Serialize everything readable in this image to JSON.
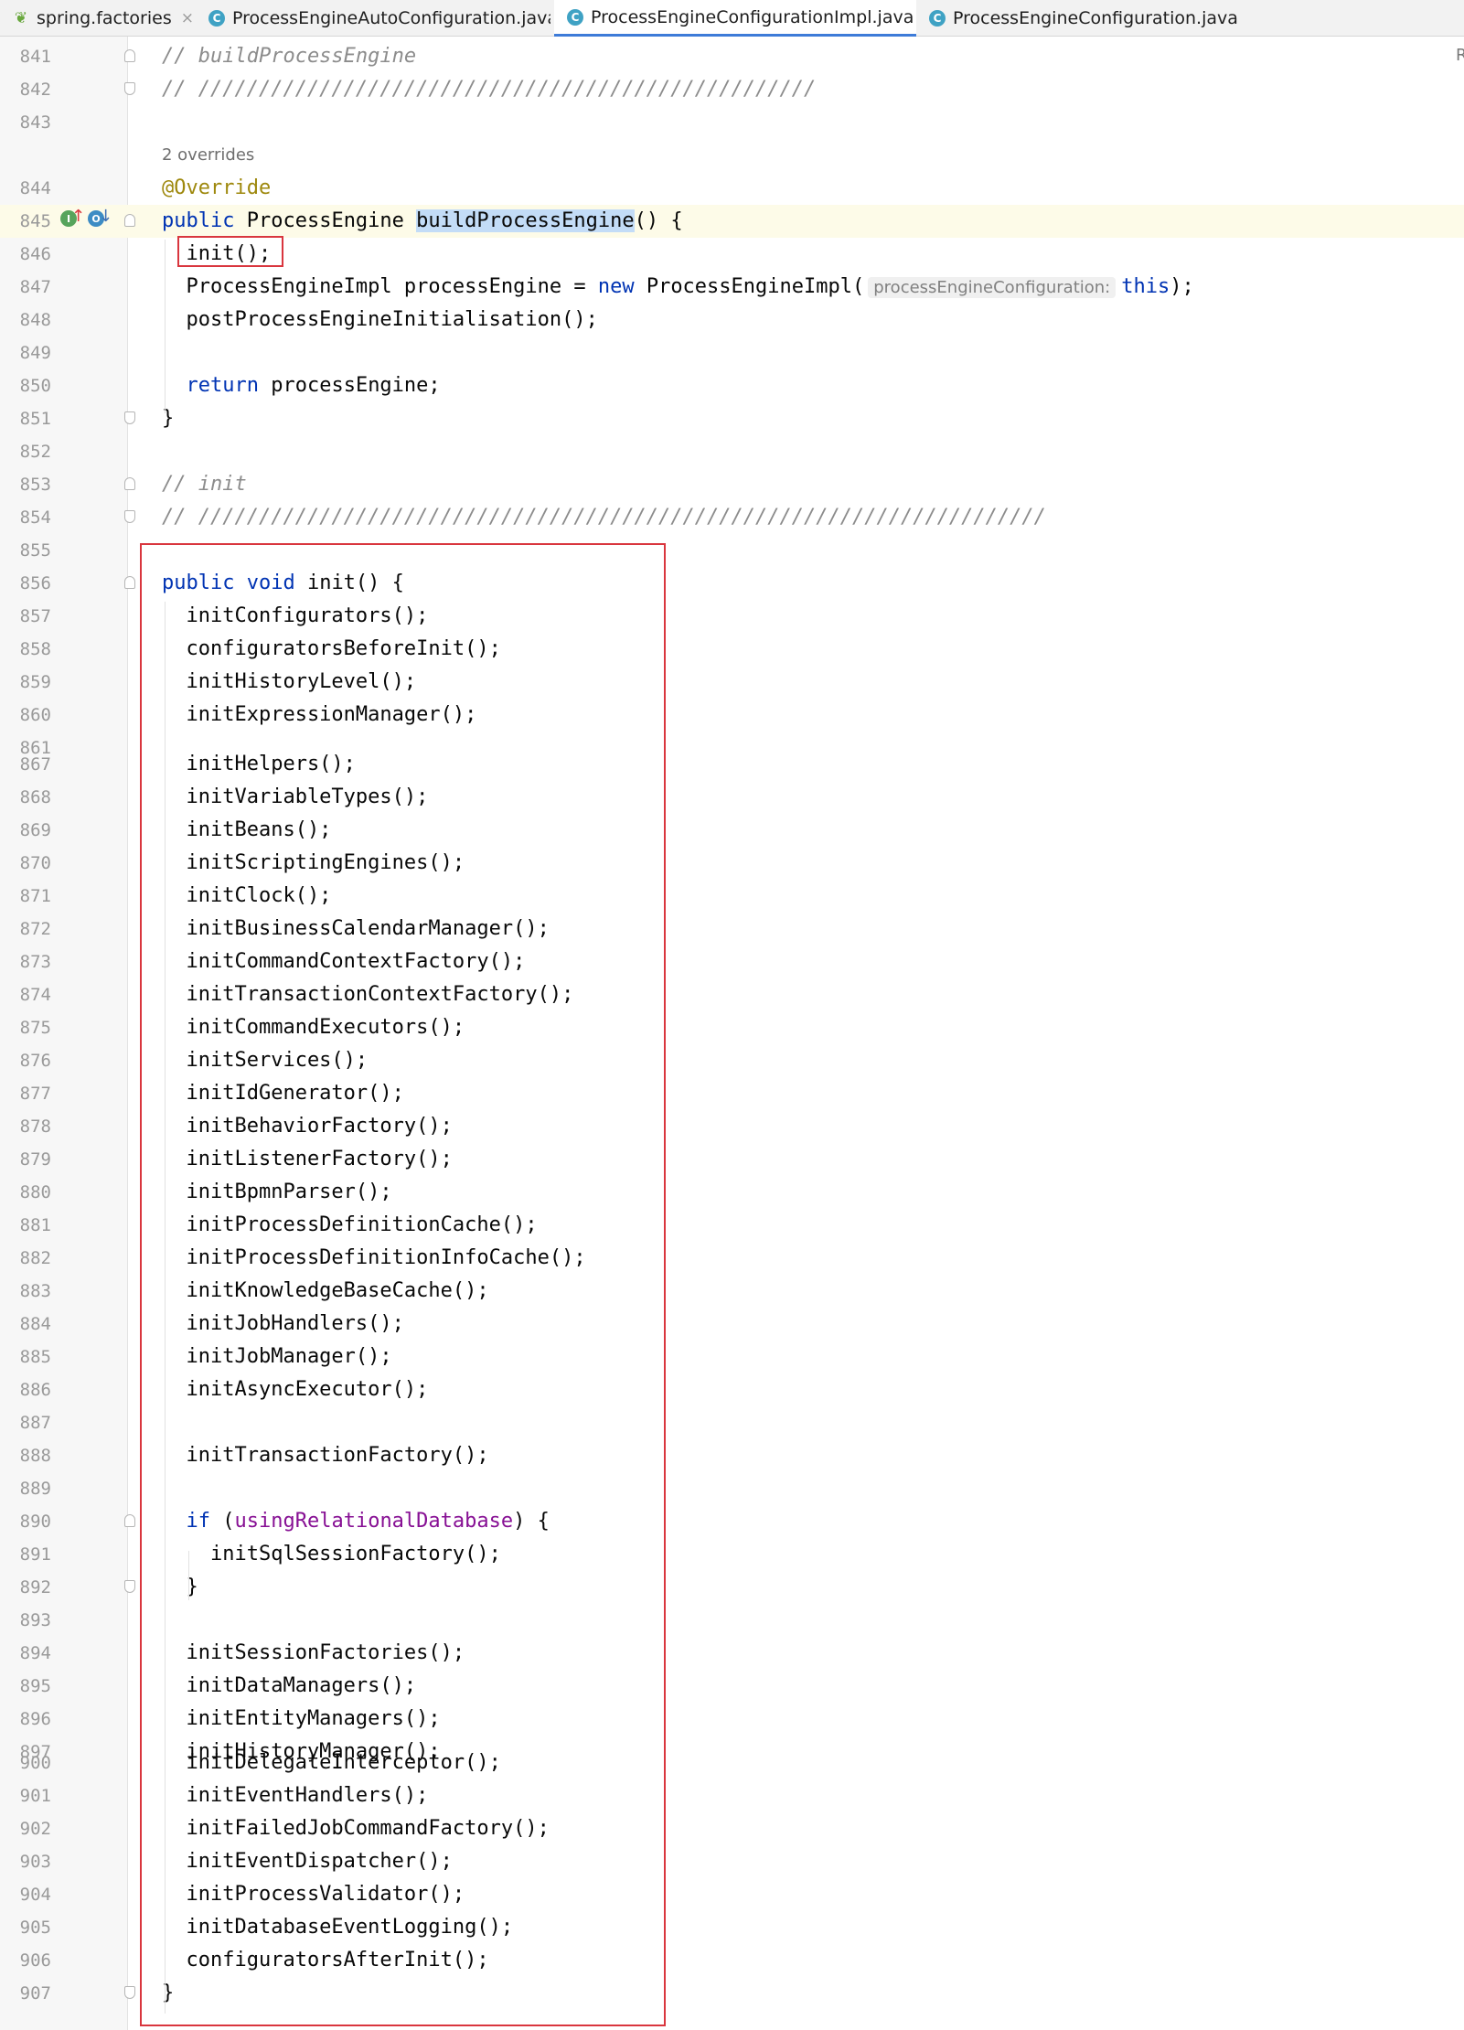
{
  "tabs": [
    {
      "label": "spring.factories",
      "icon": "spring-leaf-icon",
      "active": false
    },
    {
      "label": "ProcessEngineAutoConfiguration.java",
      "icon": "java-class-icon",
      "active": false
    },
    {
      "label": "ProcessEngineConfigurationImpl.java",
      "icon": "java-class-icon",
      "active": true
    },
    {
      "label": "ProcessEngineConfiguration.java",
      "icon": "java-class-icon",
      "active": false
    }
  ],
  "close_glyph": "×",
  "class_glyph": "C",
  "leaf_glyph": "❦",
  "right_edge_text": "R",
  "code_lens": "2 overrides",
  "gutter_marks": {
    "implements": "I",
    "overridden": "O",
    "up_arrow": "↑",
    "down_arrow": "↓"
  },
  "colors": {
    "keyword": "#0033b3",
    "comment": "#8c8c8c",
    "annotation": "#9e880d",
    "field": "#871094",
    "highlight_box": "#d9363e",
    "active_tab": "#3d7bd8"
  },
  "lines": [
    {
      "n": "841",
      "segs": [
        {
          "t": "// buildProcessEngine",
          "c": "cmt"
        }
      ]
    },
    {
      "n": "842",
      "segs": [
        {
          "t": "// ///////////////////////////////////////////////////",
          "c": "cmt"
        }
      ]
    },
    {
      "n": "843",
      "segs": []
    },
    {
      "n": "844",
      "segs": [
        {
          "t": "@Override",
          "c": "ann"
        }
      ]
    },
    {
      "n": "845",
      "segs": [
        {
          "t": "public",
          "c": "kw"
        },
        {
          "t": " ProcessEngine ",
          "c": ""
        },
        {
          "t": "buildProcessEngine",
          "c": "sel"
        },
        {
          "t": "() {",
          "c": ""
        }
      ]
    },
    {
      "n": "846",
      "segs": [
        {
          "t": "  init();",
          "c": ""
        }
      ]
    },
    {
      "n": "847",
      "segs": [
        {
          "t": "  ProcessEngineImpl processEngine = ",
          "c": ""
        },
        {
          "t": "new",
          "c": "kw"
        },
        {
          "t": " ProcessEngineImpl(",
          "c": ""
        },
        {
          "t": "processEngineConfiguration:",
          "c": "hint"
        },
        {
          "t": "this",
          "c": "kw"
        },
        {
          "t": ");",
          "c": ""
        }
      ]
    },
    {
      "n": "848",
      "segs": [
        {
          "t": "  postProcessEngineInitialisation();",
          "c": ""
        }
      ]
    },
    {
      "n": "849",
      "segs": []
    },
    {
      "n": "850",
      "segs": [
        {
          "t": "  ",
          "c": ""
        },
        {
          "t": "return",
          "c": "kw"
        },
        {
          "t": " processEngine;",
          "c": ""
        }
      ]
    },
    {
      "n": "851",
      "segs": [
        {
          "t": "}",
          "c": ""
        }
      ]
    },
    {
      "n": "852",
      "segs": []
    },
    {
      "n": "853",
      "segs": [
        {
          "t": "// init",
          "c": "cmt"
        }
      ]
    },
    {
      "n": "854",
      "segs": [
        {
          "t": "// //////////////////////////////////////////////////////////////////////",
          "c": "cmt"
        }
      ]
    },
    {
      "n": "855",
      "segs": []
    },
    {
      "n": "856",
      "segs": [
        {
          "t": "public void",
          "c": "kw"
        },
        {
          "t": " init() {",
          "c": ""
        }
      ]
    },
    {
      "n": "857",
      "segs": [
        {
          "t": "  initConfigurators();",
          "c": ""
        }
      ]
    },
    {
      "n": "858",
      "segs": [
        {
          "t": "  configuratorsBeforeInit();",
          "c": ""
        }
      ]
    },
    {
      "n": "859",
      "segs": [
        {
          "t": "  initHistoryLevel();",
          "c": ""
        }
      ]
    },
    {
      "n": "860",
      "segs": [
        {
          "t": "  initExpressionManager();",
          "c": ""
        }
      ]
    },
    {
      "n": "861",
      "segs": []
    },
    {
      "n": "867",
      "segs": [
        {
          "t": "  initHelpers();",
          "c": ""
        }
      ]
    },
    {
      "n": "868",
      "segs": [
        {
          "t": "  initVariableTypes();",
          "c": ""
        }
      ]
    },
    {
      "n": "869",
      "segs": [
        {
          "t": "  initBeans();",
          "c": ""
        }
      ]
    },
    {
      "n": "870",
      "segs": [
        {
          "t": "  initScriptingEngines();",
          "c": ""
        }
      ]
    },
    {
      "n": "871",
      "segs": [
        {
          "t": "  initClock();",
          "c": ""
        }
      ]
    },
    {
      "n": "872",
      "segs": [
        {
          "t": "  initBusinessCalendarManager();",
          "c": ""
        }
      ]
    },
    {
      "n": "873",
      "segs": [
        {
          "t": "  initCommandContextFactory();",
          "c": ""
        }
      ]
    },
    {
      "n": "874",
      "segs": [
        {
          "t": "  initTransactionContextFactory();",
          "c": ""
        }
      ]
    },
    {
      "n": "875",
      "segs": [
        {
          "t": "  initCommandExecutors();",
          "c": ""
        }
      ]
    },
    {
      "n": "876",
      "segs": [
        {
          "t": "  initServices();",
          "c": ""
        }
      ]
    },
    {
      "n": "877",
      "segs": [
        {
          "t": "  initIdGenerator();",
          "c": ""
        }
      ]
    },
    {
      "n": "878",
      "segs": [
        {
          "t": "  initBehaviorFactory();",
          "c": ""
        }
      ]
    },
    {
      "n": "879",
      "segs": [
        {
          "t": "  initListenerFactory();",
          "c": ""
        }
      ]
    },
    {
      "n": "880",
      "segs": [
        {
          "t": "  initBpmnParser();",
          "c": ""
        }
      ]
    },
    {
      "n": "881",
      "segs": [
        {
          "t": "  initProcessDefinitionCache();",
          "c": ""
        }
      ]
    },
    {
      "n": "882",
      "segs": [
        {
          "t": "  initProcessDefinitionInfoCache();",
          "c": ""
        }
      ]
    },
    {
      "n": "883",
      "segs": [
        {
          "t": "  initKnowledgeBaseCache();",
          "c": ""
        }
      ]
    },
    {
      "n": "884",
      "segs": [
        {
          "t": "  initJobHandlers();",
          "c": ""
        }
      ]
    },
    {
      "n": "885",
      "segs": [
        {
          "t": "  initJobManager();",
          "c": ""
        }
      ]
    },
    {
      "n": "886",
      "segs": [
        {
          "t": "  initAsyncExecutor();",
          "c": ""
        }
      ]
    },
    {
      "n": "887",
      "segs": []
    },
    {
      "n": "888",
      "segs": [
        {
          "t": "  initTransactionFactory();",
          "c": ""
        }
      ]
    },
    {
      "n": "889",
      "segs": []
    },
    {
      "n": "890",
      "segs": [
        {
          "t": "  ",
          "c": ""
        },
        {
          "t": "if",
          "c": "kw"
        },
        {
          "t": " (",
          "c": ""
        },
        {
          "t": "usingRelationalDatabase",
          "c": "fld"
        },
        {
          "t": ") {",
          "c": ""
        }
      ]
    },
    {
      "n": "891",
      "segs": [
        {
          "t": "    initSqlSessionFactory();",
          "c": ""
        }
      ]
    },
    {
      "n": "892",
      "segs": [
        {
          "t": "  }",
          "c": ""
        }
      ]
    },
    {
      "n": "893",
      "segs": []
    },
    {
      "n": "894",
      "segs": [
        {
          "t": "  initSessionFactories();",
          "c": ""
        }
      ]
    },
    {
      "n": "895",
      "segs": [
        {
          "t": "  initDataManagers();",
          "c": ""
        }
      ]
    },
    {
      "n": "896",
      "segs": [
        {
          "t": "  initEntityManagers();",
          "c": ""
        }
      ]
    },
    {
      "n": "897",
      "segs": [
        {
          "t": "  initHistoryManager();",
          "c": ""
        }
      ]
    },
    {
      "n": "900",
      "segs": [
        {
          "t": "  initDelegateInterceptor();",
          "c": ""
        }
      ]
    },
    {
      "n": "901",
      "segs": [
        {
          "t": "  initEventHandlers();",
          "c": ""
        }
      ]
    },
    {
      "n": "902",
      "segs": [
        {
          "t": "  initFailedJobCommandFactory();",
          "c": ""
        }
      ]
    },
    {
      "n": "903",
      "segs": [
        {
          "t": "  initEventDispatcher();",
          "c": ""
        }
      ]
    },
    {
      "n": "904",
      "segs": [
        {
          "t": "  initProcessValidator();",
          "c": ""
        }
      ]
    },
    {
      "n": "905",
      "segs": [
        {
          "t": "  initDatabaseEventLogging();",
          "c": ""
        }
      ]
    },
    {
      "n": "906",
      "segs": [
        {
          "t": "  configuratorsAfterInit();",
          "c": ""
        }
      ]
    },
    {
      "n": "907",
      "segs": [
        {
          "t": "}",
          "c": ""
        }
      ]
    }
  ]
}
